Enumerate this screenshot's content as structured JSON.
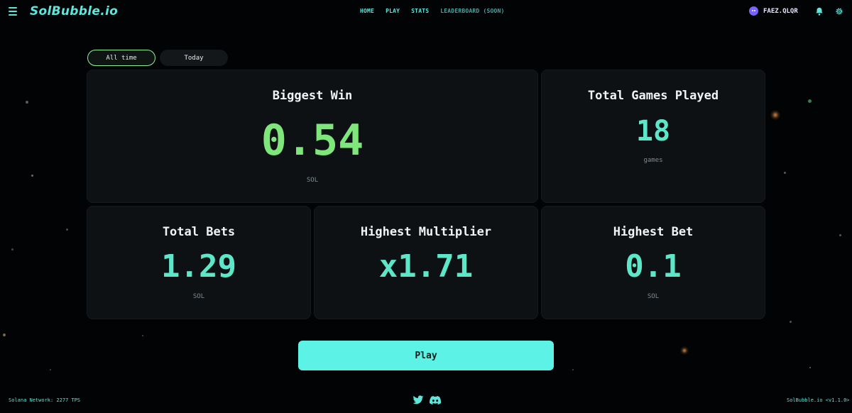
{
  "header": {
    "logo": "SolBubble.io",
    "nav": [
      "HOME",
      "PLAY",
      "STATS"
    ],
    "nav_soon": "LEADERBOARD (SOON)",
    "username": "FAEZ.QLQR"
  },
  "filters": {
    "all_time": "All time",
    "today": "Today",
    "active": "All time"
  },
  "stats": {
    "biggest_win": {
      "title": "Biggest Win",
      "value": "0.54",
      "unit": "SOL"
    },
    "total_games": {
      "title": "Total Games Played",
      "value": "18",
      "unit": "games"
    },
    "total_bets": {
      "title": "Total Bets",
      "value": "1.29",
      "unit": "SOL"
    },
    "highest_multiplier": {
      "title": "Highest Multiplier",
      "value": "x1.71"
    },
    "highest_bet": {
      "title": "Highest Bet",
      "value": "0.1",
      "unit": "SOL"
    }
  },
  "play_button": "Play",
  "footer": {
    "network": "Solana Network: 2277 TPS",
    "version": "SolBubble.io <v1.1.0>"
  },
  "icons": {
    "menu": "menu-icon",
    "bell": "bell-icon",
    "settings": "gear-icon",
    "twitter": "twitter-icon",
    "discord": "discord-icon"
  },
  "colors": {
    "accent": "#5ee6da",
    "win_green": "#7ee67a",
    "stat_teal": "#5ee6c9",
    "play_button": "#5df2e6",
    "card_bg": "#0e1114",
    "avatar": "#7b61ff"
  }
}
